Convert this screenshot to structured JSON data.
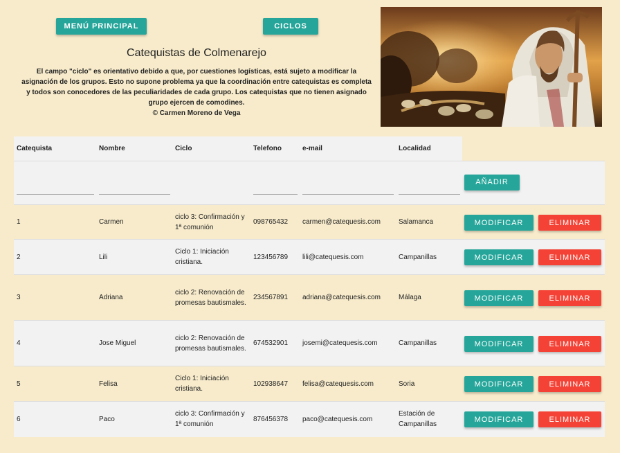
{
  "header": {
    "menu_label": "MENÚ PRINCIPAL",
    "ciclos_label": "CICLOS",
    "title": "Catequistas de Colmenarejo",
    "intro": "El campo \"ciclo\" es orientativo debido a que, por cuestiones logísticas, está sujeto a modificar la asignación de los grupos. Esto no supone problema ya que la coordinación entre catequistas es completa y todos son conocedores de las peculiaridades de cada grupo. Los catequistas que no tienen asignado grupo ejercen de comodines.",
    "copyright": "© Carmen Moreno de Vega"
  },
  "table": {
    "headers": [
      "Catequista",
      "Nombre",
      "Ciclo",
      "Telefono",
      "e-mail",
      "Localidad"
    ],
    "add_label": "AÑADIR",
    "modify_label": "MODIFICAR",
    "delete_label": "ELIMINAR",
    "rows": [
      {
        "id": "1",
        "nombre": "Carmen",
        "ciclo": "ciclo 3: Confirmación y 1ª comunión",
        "telefono": "098765432",
        "email": "carmen@catequesis.com",
        "localidad": "Salamanca"
      },
      {
        "id": "2",
        "nombre": "Lili",
        "ciclo": "Ciclo 1: Iniciación cristiana.",
        "telefono": "123456789",
        "email": "lili@catequesis.com",
        "localidad": "Campanillas"
      },
      {
        "id": "3",
        "nombre": "Adriana",
        "ciclo": "ciclo 2: Renovación de promesas bautismales.",
        "telefono": "234567891",
        "email": "adriana@catequesis.com",
        "localidad": "Málaga"
      },
      {
        "id": "4",
        "nombre": "Jose Miguel",
        "ciclo": "ciclo 2: Renovación de promesas bautismales.",
        "telefono": "674532901",
        "email": "josemi@catequesis.com",
        "localidad": "Campanillas"
      },
      {
        "id": "5",
        "nombre": "Felisa",
        "ciclo": "Ciclo 1: Iniciación cristiana.",
        "telefono": "102938647",
        "email": "felisa@catequesis.com",
        "localidad": "Soria"
      },
      {
        "id": "6",
        "nombre": "Paco",
        "ciclo": "ciclo 3: Confirmación y 1ª comunión",
        "telefono": "876456378",
        "email": "paco@catequesis.com",
        "localidad": "Estación de Campanillas"
      }
    ]
  },
  "colors": {
    "teal": "#26a69a",
    "red": "#f44336",
    "background": "#f7ebcb",
    "row_alt": "#f2f2f2"
  }
}
